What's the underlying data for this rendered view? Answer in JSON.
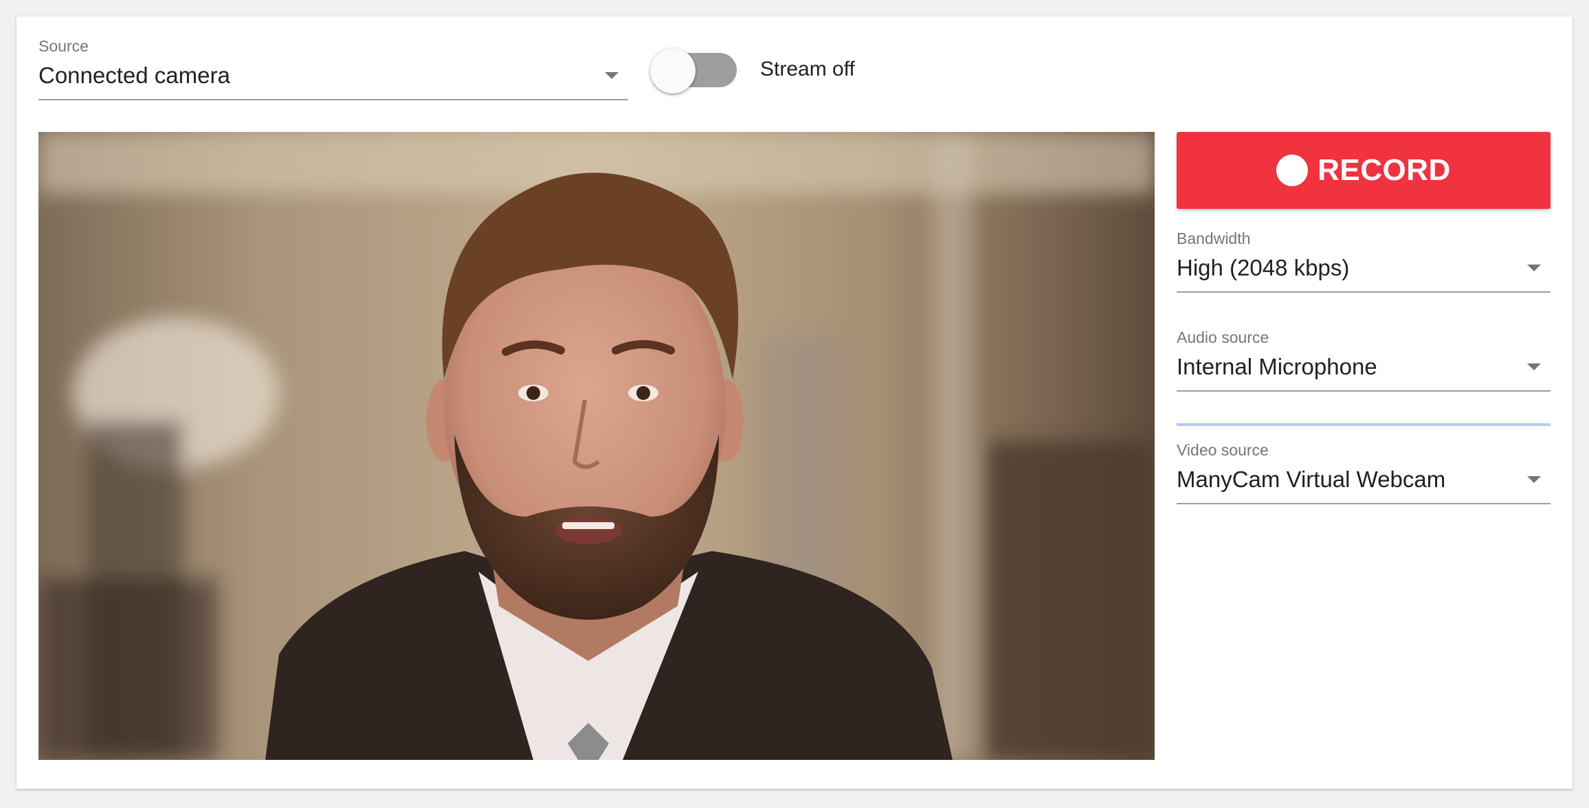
{
  "source": {
    "label": "Source",
    "value": "Connected camera"
  },
  "stream": {
    "label": "Stream off",
    "on": false
  },
  "record": {
    "label": "RECORD",
    "color": "#f0333f"
  },
  "bandwidth": {
    "label": "Bandwidth",
    "value": "High (2048 kbps)"
  },
  "audio_source": {
    "label": "Audio source",
    "value": "Internal Microphone"
  },
  "video_source": {
    "label": "Video source",
    "value": "ManyCam Virtual Webcam"
  },
  "icons": {
    "dropdown": "triangle-down-icon",
    "record": "record-dot-icon"
  }
}
